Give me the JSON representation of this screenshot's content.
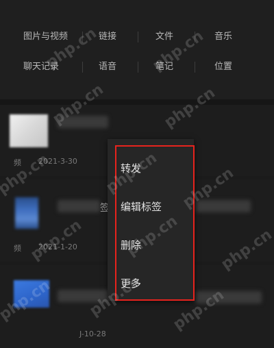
{
  "filters": {
    "row1": [
      "图片与视频",
      "链接",
      "文件",
      "音乐"
    ],
    "row2": [
      "聊天记录",
      "语音",
      "笔记",
      "位置"
    ]
  },
  "items": [
    {
      "source": "频",
      "date": "2021-3-30",
      "partial_text": ""
    },
    {
      "source": "频",
      "date": "2021-1-20",
      "partial_text": "签"
    },
    {
      "source": "",
      "date": "J-10-28",
      "partial_text": ""
    }
  ],
  "context_menu": {
    "items": [
      "转发",
      "编辑标签",
      "删除",
      "更多"
    ]
  },
  "watermark": {
    "text": "php.cn"
  },
  "colors": {
    "background": "#1b1b1b",
    "menu_background": "#262626",
    "highlight_border": "#e8231d"
  }
}
